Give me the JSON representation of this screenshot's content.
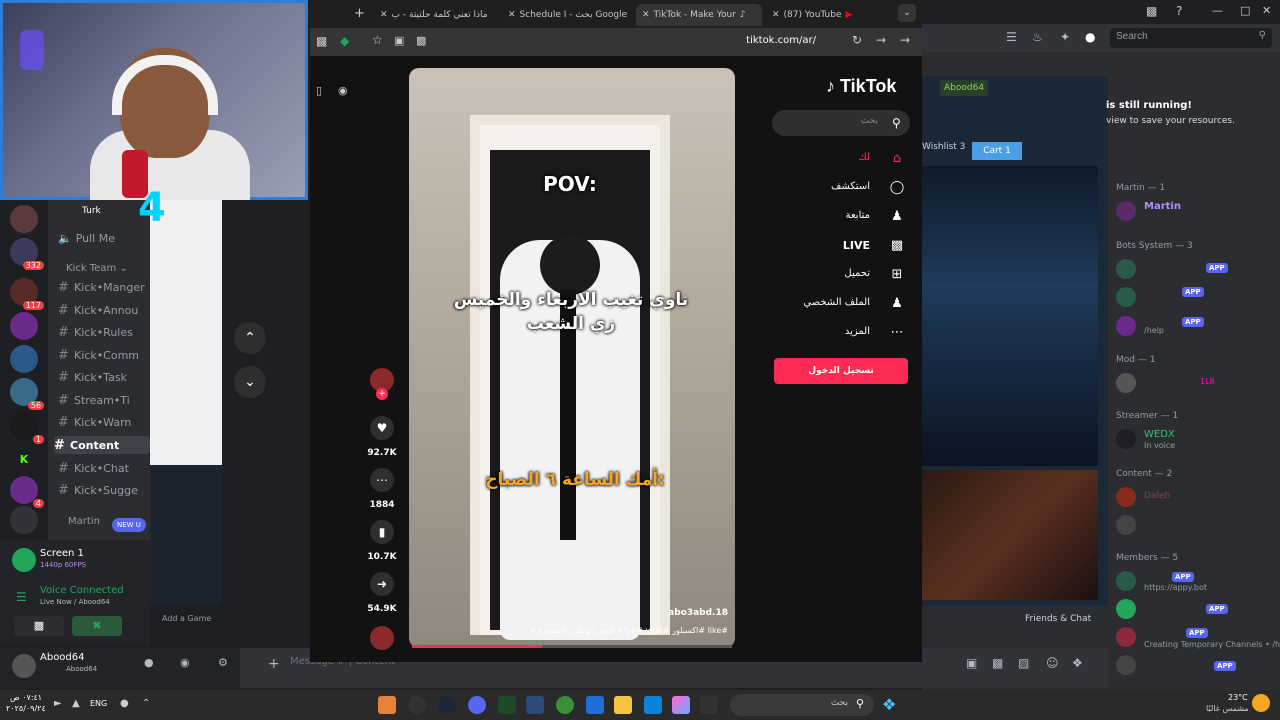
{
  "browser": {
    "tabs": [
      {
        "label": "ماذا تعني كلمة حلتيتة - ب"
      },
      {
        "label": "Schedule I - بحث Google"
      },
      {
        "label": "TikTok - Make Your"
      },
      {
        "label": "(87) YouTube"
      }
    ],
    "url": "tiktok.com/ar/"
  },
  "tiktok": {
    "logo": "TikTok",
    "search_placeholder": "بحث",
    "nav": [
      {
        "label": "لك",
        "icon": "home-icon"
      },
      {
        "label": "استكشف",
        "icon": "compass-icon"
      },
      {
        "label": "متابعة",
        "icon": "follow-icon"
      },
      {
        "label": "LIVE",
        "icon": "live-icon"
      },
      {
        "label": "تحميل",
        "icon": "upload-icon"
      },
      {
        "label": "الملف الشخصي",
        "icon": "profile-icon"
      },
      {
        "label": "المزيد",
        "icon": "more-icon"
      }
    ],
    "login_button": "تسجيل الدخول",
    "video": {
      "text_top": "POV:",
      "text_middle": "ناوي تغيب الاربعاء والخميس زي الشعب",
      "text_bottom": "أمك الساعة ٦ الصباح:",
      "author": "abo3abd.18",
      "hashtags": "#اليوم_الوطني_السعودي #fyp# viral# اكسبلور# like#"
    },
    "actions": {
      "likes": "92.7K",
      "comments": "1884",
      "saves": "10.7K",
      "shares": "54.9K"
    }
  },
  "discord_left": {
    "badges": [
      "332",
      "117",
      "56",
      "1",
      "4"
    ],
    "channels": [
      {
        "label": "Turk"
      },
      {
        "label": "Pull Me"
      },
      {
        "label": "Kick•Manger"
      },
      {
        "label": "Kick•Annou"
      },
      {
        "label": "Kick•Rules"
      },
      {
        "label": "Kick•Comm"
      },
      {
        "label": "Kick•Task"
      },
      {
        "label": "Stream•Ti"
      },
      {
        "label": "Kick•Warn"
      },
      {
        "label": "Content"
      },
      {
        "label": "Kick•Chat"
      },
      {
        "label": "Kick•Sugge"
      }
    ],
    "category_kick_team": "Kick Team",
    "category_martin": "Martin",
    "new_unreads": "NEW U",
    "screen_share": {
      "title": "Screen 1",
      "sub": "1440p 60FPS"
    },
    "voice": {
      "status": "Voice Connected",
      "sub": "Live Now / Abood64"
    },
    "user": {
      "name": "Abood64",
      "sub": "Abood64"
    },
    "add_game": "Add a Game",
    "message_placeholder": "Message # | Content"
  },
  "discord_right": {
    "search_placeholder": "Search",
    "still_running": "is still running!",
    "save_resources": "view to save your resources.",
    "steam_user": "Abood64",
    "wishlist": "Wishlist 3",
    "cart": "Cart 1",
    "friends_chat": "Friends & Chat",
    "members": [
      {
        "section": "Martin — 1",
        "name": "Martin"
      },
      {
        "section": "Bots System — 3",
        "name": "/help"
      },
      {
        "section": "Mod — 1",
        "name": "1L8"
      },
      {
        "section": "Streamer — 1",
        "name": "WEDX",
        "sub": "In voice"
      },
      {
        "section": "Content — 2",
        "name": "Daleh"
      },
      {
        "section": "Members — 5",
        "name": "https://appy.bot"
      }
    ],
    "temp_channels": "Creating Temporary Channels • /h..."
  },
  "taskbar": {
    "search": "بحث",
    "lang": "ENG",
    "time": "٠٧:٤١ ص",
    "date": "٢٠٢٥/٠٩/٢٤",
    "weather_temp": "23°C",
    "weather_desc": "مشمس غالبًا"
  }
}
